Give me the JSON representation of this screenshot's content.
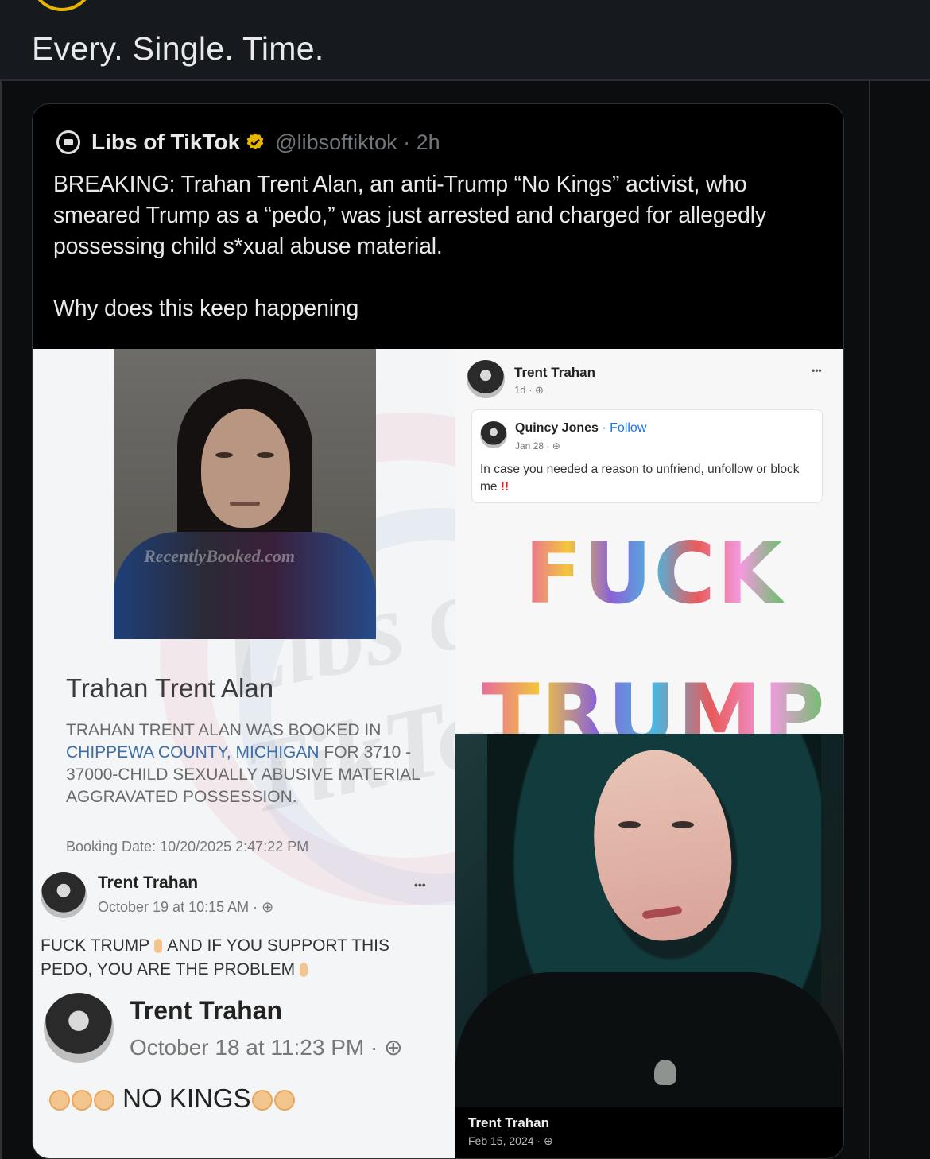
{
  "post": {
    "text": "Every. Single. Time."
  },
  "quoted": {
    "name": "Libs of TikTok",
    "handle_time": "@libsoftiktok · 2h",
    "body": "BREAKING: Trahan Trent Alan, an anti-Trump “No Kings” activist, who smeared Trump as a “pedo,” was just arrested and charged for allegedly possessing child s*xual abuse material.",
    "question": "Why does this keep happening"
  },
  "collage": {
    "mugshot_watermark": "RecentlyBooked.com",
    "booking_name": "Trahan Trent Alan",
    "booked_pre": "TRAHAN TRENT ALAN WAS BOOKED IN",
    "booked_location": "CHIPPEWA COUNTY, MICHIGAN",
    "booked_for": "FOR",
    "booked_charge": "3710 - 37000-CHILD SEXUALLY ABUSIVE MATERIAL AGGRAVATED POSSESSION.",
    "booking_date": "Booking Date: 10/20/2025 2:47:22 PM",
    "fb_post1": {
      "name": "Trent Trahan",
      "date": "October 19 at 10:15 AM · ⊕",
      "more": "•••",
      "text1": "FUCK TRUMP",
      "text2": "AND IF YOU SUPPORT THIS PEDO, YOU ARE THE PROBLEM"
    },
    "fb_post2": {
      "name": "Trent Trahan",
      "date": "October 18 at 11:23 PM · ⊕",
      "text": "NO KINGS"
    },
    "fb_share": {
      "name": "Trent Trahan",
      "date": "1d · ⊕",
      "more": "•••",
      "shared_name": "Quincy Jones",
      "follow": "· Follow",
      "shared_date": "Jan 28 · ⊕",
      "shared_text": "In case you needed a reason to unfriend, unfollow or block me",
      "exclaim": "!!",
      "word1": "FUCK",
      "word2": "TRUMP"
    },
    "selfie_caption": {
      "name": "Trent Trahan",
      "date": "Feb 15, 2024 · ⊕"
    }
  },
  "colors": {
    "background": "#15181c",
    "card": "#000000",
    "verified": "#e8b600",
    "link_blue": "#1877f2"
  },
  "icons": [
    "libs-of-tiktok-logo-icon",
    "verified-badge-icon",
    "globe-icon",
    "clap-icon",
    "more-icon"
  ]
}
